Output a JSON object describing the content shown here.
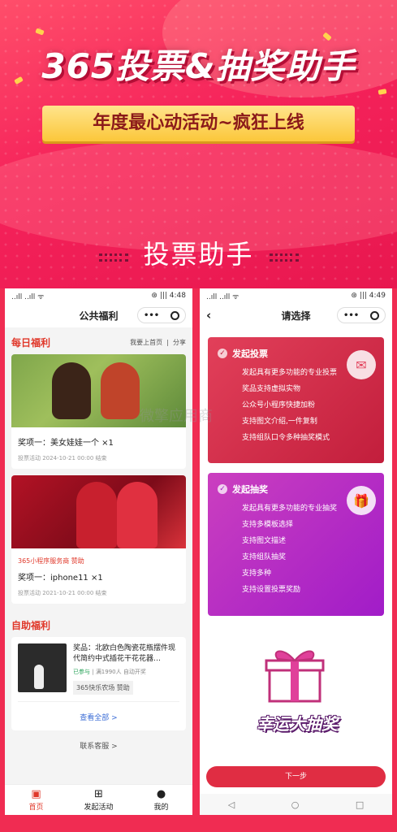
{
  "hero": {
    "title": "365投票&抽奖助手",
    "ribbon": "年度最心动活动~疯狂上线",
    "section": "投票助手"
  },
  "phone1": {
    "status": {
      "left": "..ıll ..ıll ᯤ",
      "right": "⊛ ||| 4:48"
    },
    "nav_title": "公共福利",
    "daily": {
      "heading": "每日福利",
      "link1": "我要上首页",
      "sep": "|",
      "link2": "分享"
    },
    "cards": [
      {
        "prize": "奖项一：美女娃娃一个 ×1",
        "date": "投票活动 2024-10-21 00:00 结束"
      },
      {
        "sponsor": "365小程序服务商  赞助",
        "prize": "奖项一：iphone11 ×1",
        "date": "投票活动 2021-10-21 00:00 结束"
      }
    ],
    "self": {
      "heading": "自助福利",
      "item": {
        "title": "奖品：北欧白色陶瓷花瓶摆件现代简约中式插花干花花器…",
        "joined": "已参与",
        "meta": "满1990人 自动开奖",
        "tag": "365快乐农场 赞助"
      },
      "view_all": "查看全部 >"
    },
    "contact": "联系客服 >",
    "tabs": [
      {
        "label": "首页",
        "icon": "home-icon"
      },
      {
        "label": "发起活动",
        "icon": "plus-icon"
      },
      {
        "label": "我的",
        "icon": "user-icon"
      }
    ]
  },
  "phone2": {
    "status": {
      "left": "..ıll ..ıll ᯤ",
      "right": "⊛ ||| 4:49"
    },
    "nav_title": "请选择",
    "vote": {
      "title": "发起投票",
      "items": [
        "发起具有更多功能的专业投票",
        "奖品支持虚拟实物",
        "公众号小程序快捷加粉",
        "支持图文介绍,一件复制",
        "支持组队口令多种抽奖模式"
      ]
    },
    "lottery": {
      "title": "发起抽奖",
      "items": [
        "发起具有更多功能的专业抽奖",
        "支持多模板选择",
        "支持图文描述",
        "支持组队抽奖",
        "支持多种",
        "支持设置投票奖励"
      ]
    },
    "banner": "幸运大抽奖",
    "next": "下一步",
    "sysnav": [
      "◁",
      "○",
      "□"
    ]
  },
  "watermark": "微擎应用商"
}
